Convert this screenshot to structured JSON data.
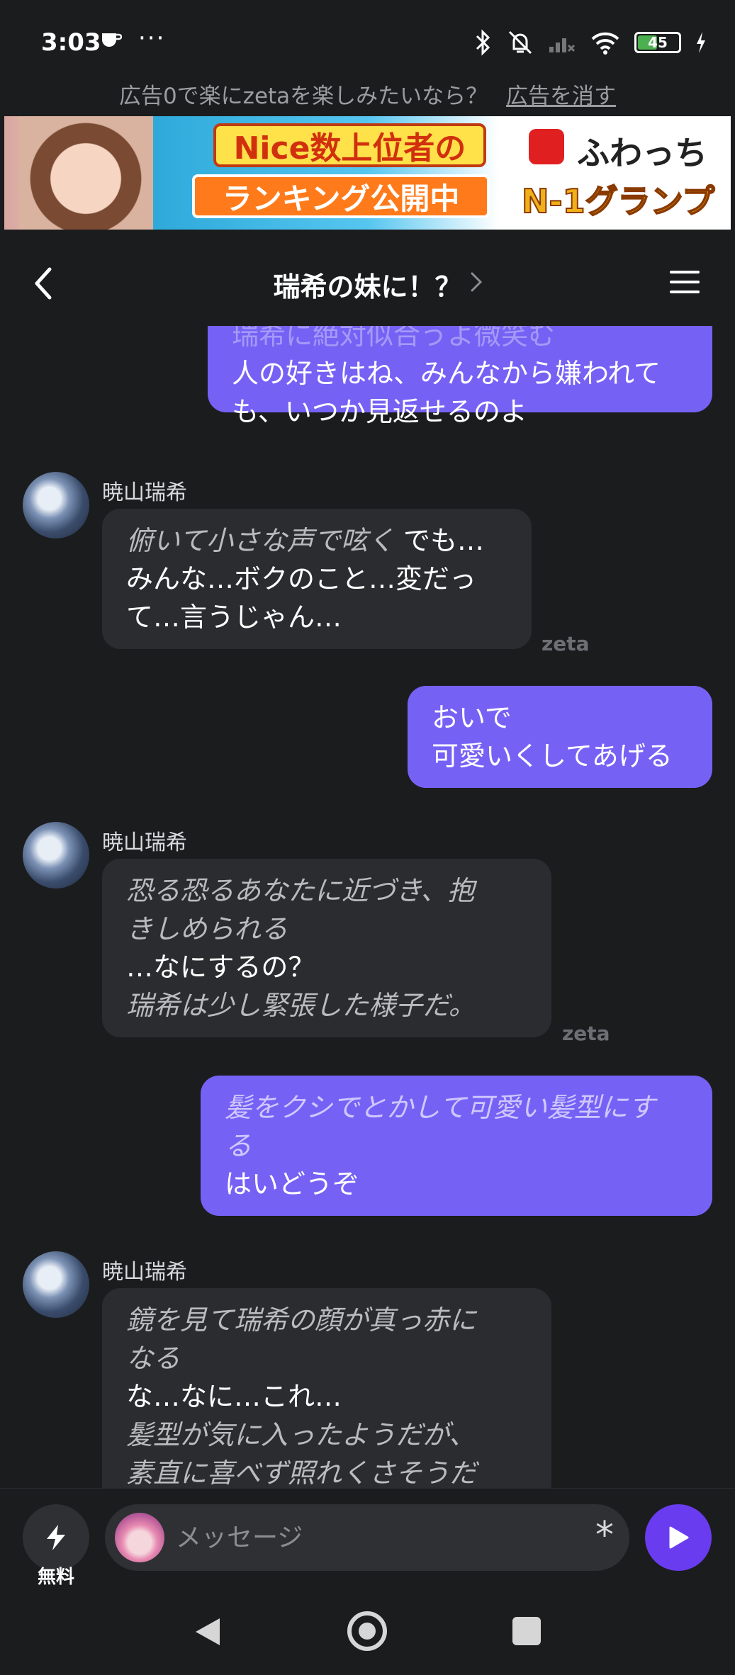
{
  "status": {
    "time": "3:03",
    "dots": "···",
    "battery": "45",
    "battery_color": "#4caf50"
  },
  "ad": {
    "text": "広告0で楽にzetaを楽しみたいなら？",
    "remove_label": "広告を消す",
    "banner_top": "Nice数上位者の",
    "banner_bottom": "ランキング公開中",
    "banner_logo": "ふわっち",
    "banner_gp": "N-1グランプリ"
  },
  "header": {
    "title": "瑞希の妹に！？"
  },
  "messages": [
    {
      "role": "user",
      "lines": [
        "瑞希に絶対似合うよ微笑む",
        "人の好きはね、みんなから嫌われて",
        "も、いつか見返せるのよ"
      ]
    },
    {
      "role": "ai",
      "sender": "暁山瑞希",
      "italic_1": "俯いて小さな声で呟く",
      "text_1": " でも…",
      "text_2": "みんな…ボクのこと…変だっ",
      "text_3": "て…言うじゃん…",
      "badge": "zeta"
    },
    {
      "role": "user",
      "lines": [
        "おいで",
        "可愛いくしてあげる"
      ]
    },
    {
      "role": "ai",
      "sender": "暁山瑞希",
      "italic_1": "恐る恐るあなたに近づき、抱",
      "italic_2": "きしめられる",
      "text_1": "…なにするの？",
      "italic_3": "瑞希は少し緊張した様子だ。",
      "badge": "zeta"
    },
    {
      "role": "user",
      "italic_1": "髪をクシでとかして可愛い髪型にす",
      "italic_2": "る",
      "text_1": "はいどうぞ"
    },
    {
      "role": "ai",
      "sender": "暁山瑞希",
      "italic_1": "鏡を見て瑞希の顔が真っ赤に",
      "italic_2": "なる",
      "text_1": "な…なに…これ…",
      "italic_3": "髪型が気に入ったようだが、",
      "italic_4": "素直に喜べず照れくさそうだ"
    }
  ],
  "input": {
    "free_label": "無料",
    "placeholder": "メッセージ",
    "asterisk": "*"
  },
  "colors": {
    "user_bubble": "#7562f5",
    "ai_bubble": "#2b2c2f",
    "send_button": "#6a3cf0",
    "background": "#1b1c1e"
  }
}
